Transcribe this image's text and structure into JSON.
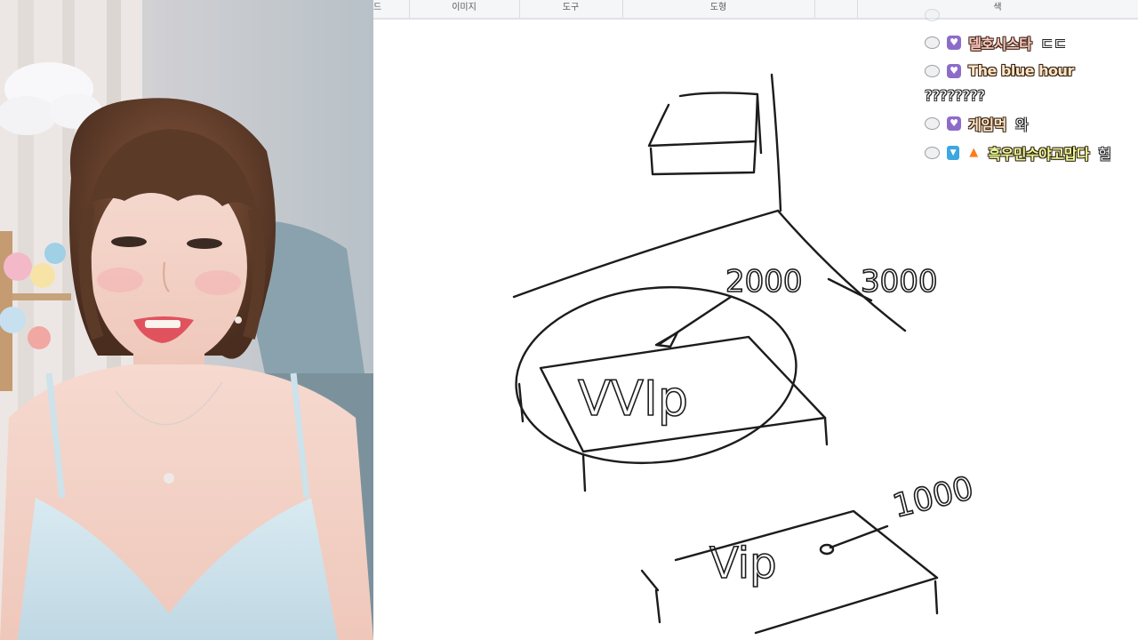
{
  "toolbar": {
    "groups": [
      "드",
      "이미지",
      "도구",
      "도형",
      "",
      "색"
    ]
  },
  "canvas": {
    "labels": {
      "box_large": "VVIp",
      "box_small": "Vip",
      "price_left": "2000",
      "price_right": "3000",
      "price_small": "1000"
    }
  },
  "chat": {
    "messages": [
      {
        "nick": "",
        "text": "",
        "faded": true
      },
      {
        "nick": "델호시스타",
        "text": "ㄷㄷ"
      },
      {
        "nick": "The blue hour",
        "text": "????????"
      },
      {
        "nick": "게임먹",
        "text": "와"
      },
      {
        "nick": "흑우민수야고맙다",
        "text": "헐"
      }
    ]
  },
  "colors": {
    "nick_default": "#ffe7c7",
    "nick_green": "#e8ff9a",
    "heart_badge": "#8d6cc9",
    "toolbar_bg": "#f5f6f7"
  },
  "icons": [
    "user-level-icon",
    "subscriber-heart-icon",
    "fan-badge-icon",
    "fire-icon"
  ]
}
